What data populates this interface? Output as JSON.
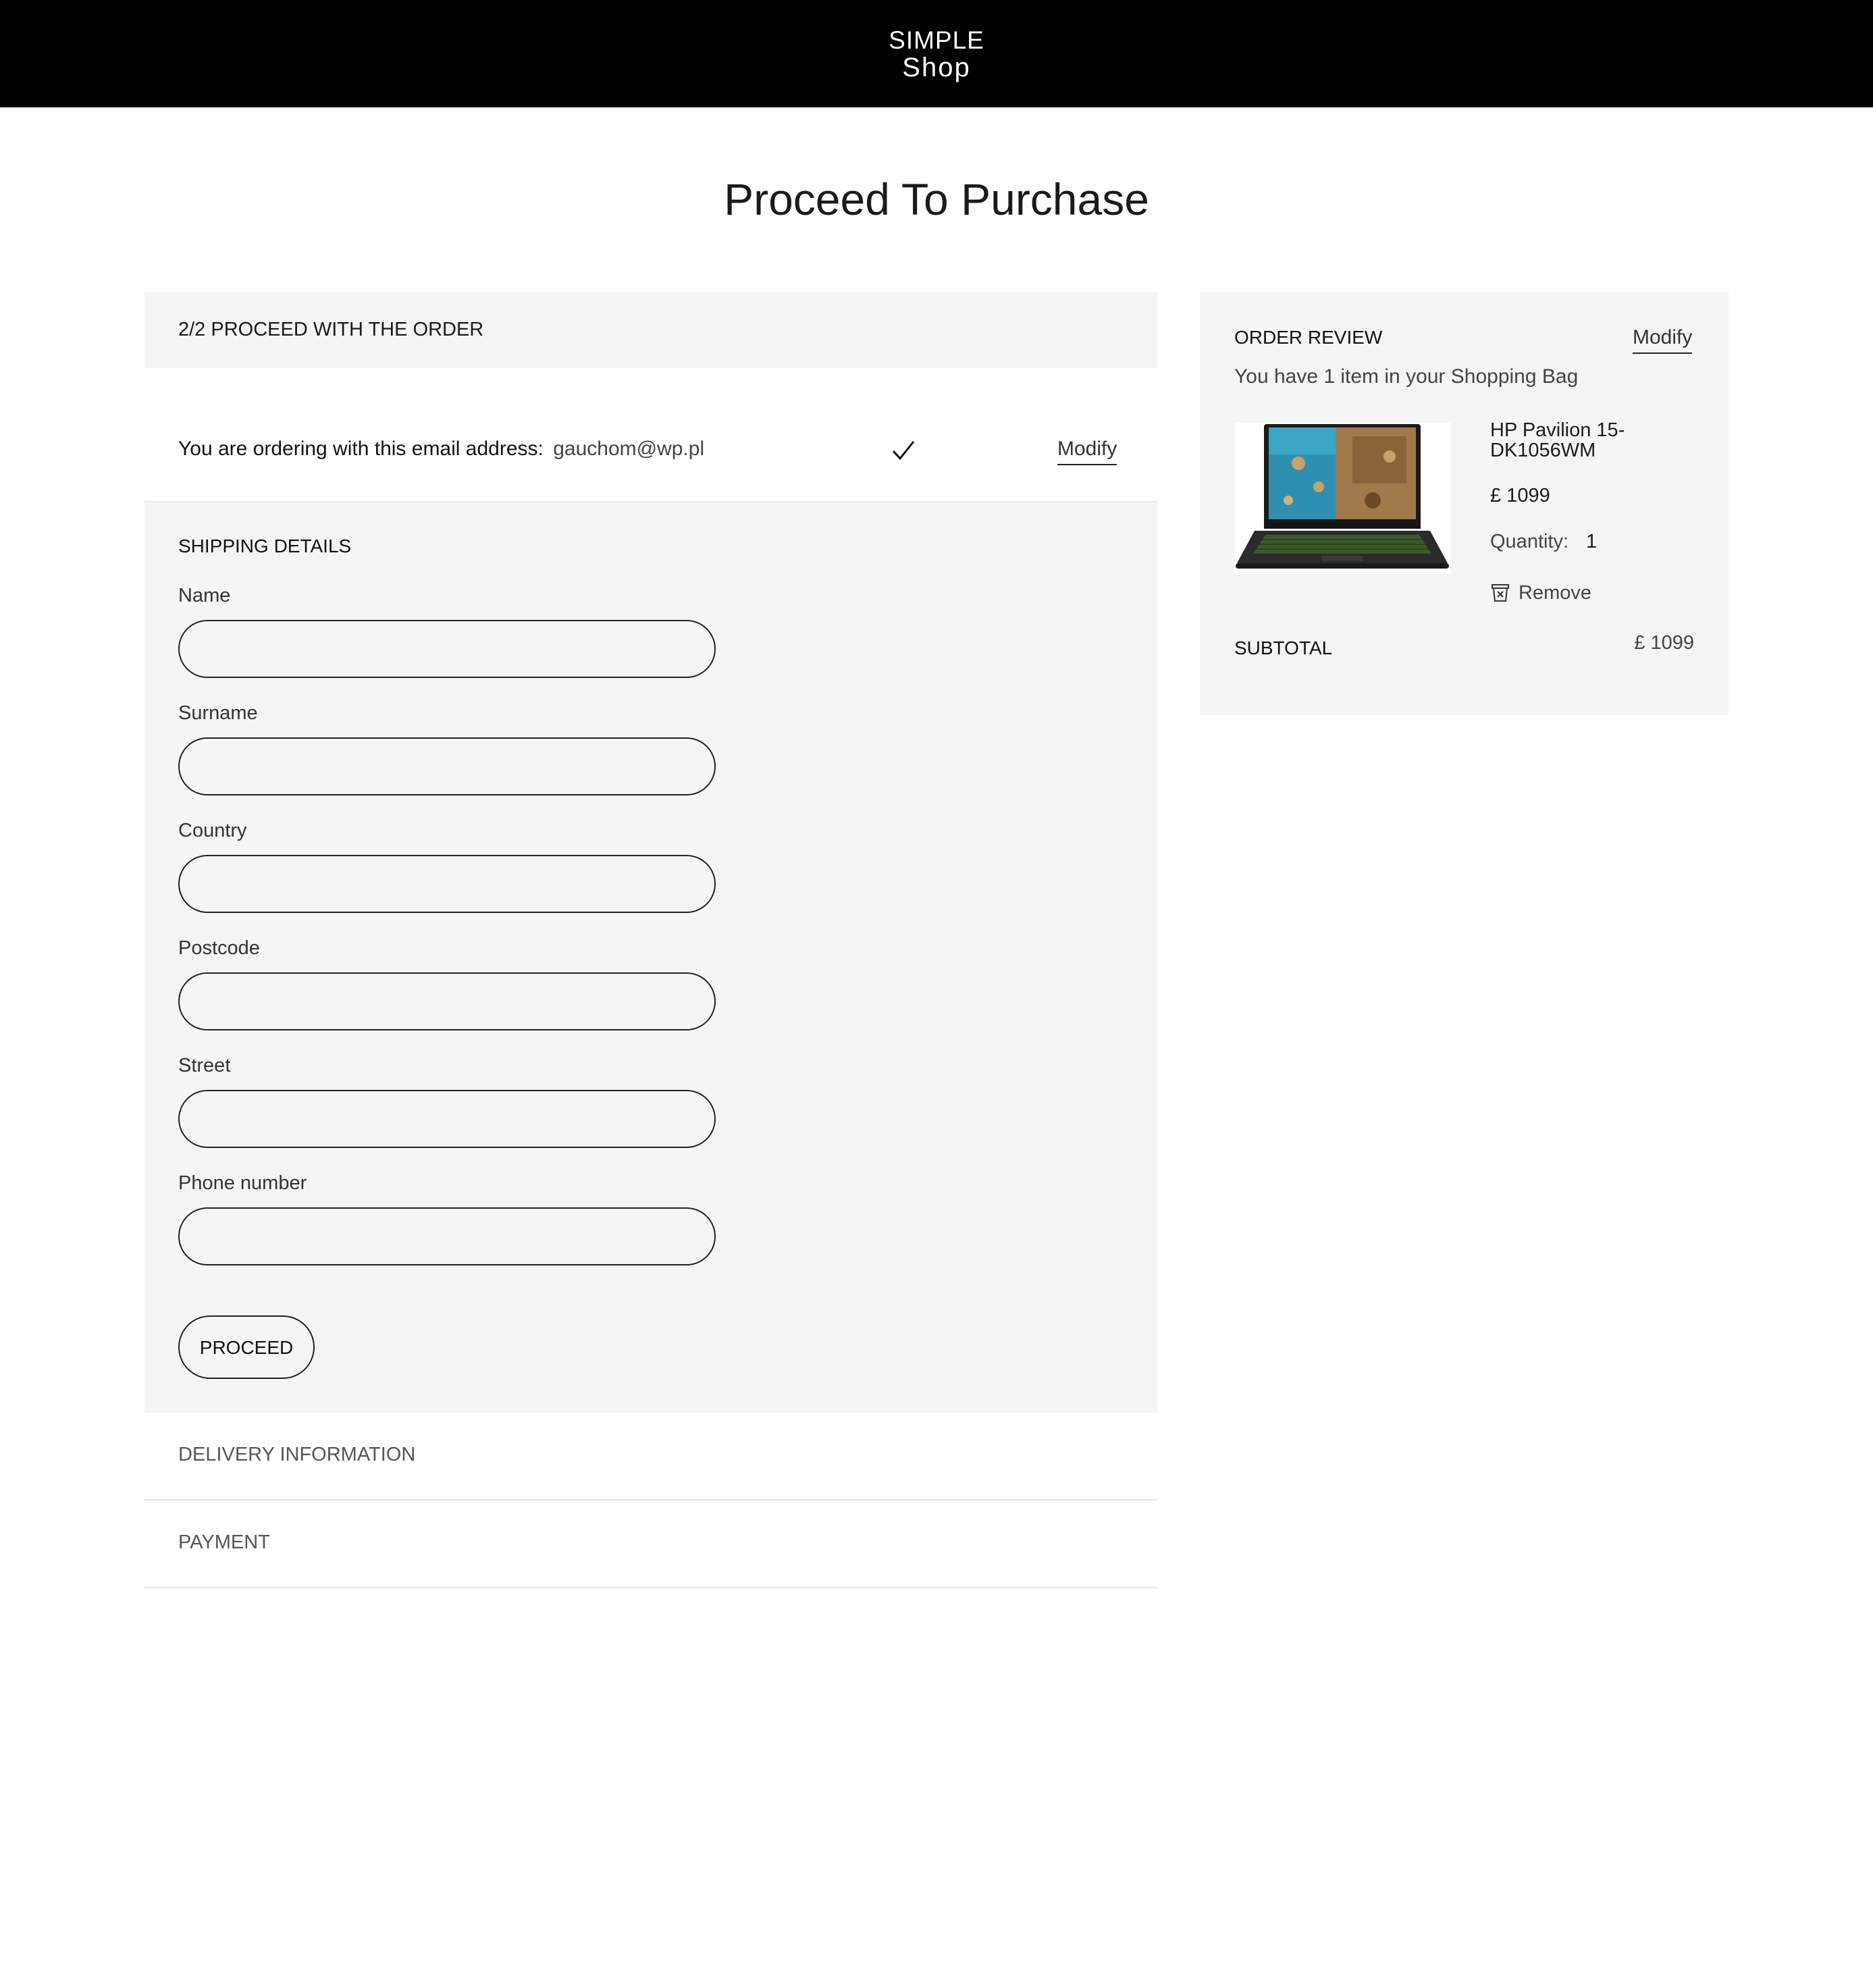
{
  "header": {
    "logo_line1": "SIMPLE",
    "logo_line2": "Shop"
  },
  "page_title": "Proceed To Purchase",
  "checkout": {
    "step_label": "2/2 PROCEED WITH THE ORDER",
    "email": {
      "label": "You are ordering with this email address:",
      "value": "gauchom@wp.pl",
      "modify_label": "Modify",
      "verified_icon": "check-icon"
    },
    "shipping": {
      "title": "SHIPPING DETAILS",
      "fields": [
        {
          "label": "Name",
          "value": "",
          "placeholder": ""
        },
        {
          "label": "Surname",
          "value": "",
          "placeholder": ""
        },
        {
          "label": "Country",
          "value": "",
          "placeholder": ""
        },
        {
          "label": "Postcode",
          "value": "",
          "placeholder": ""
        },
        {
          "label": "Street",
          "value": "",
          "placeholder": ""
        },
        {
          "label": "Phone number",
          "value": "",
          "placeholder": ""
        }
      ],
      "proceed_label": "PROCEED"
    },
    "delivery_label": "DELIVERY INFORMATION",
    "payment_label": "PAYMENT"
  },
  "order_review": {
    "title": "ORDER REVIEW",
    "modify_label": "Modify",
    "summary": "You have 1 item in your Shopping Bag",
    "item": {
      "name": "HP Pavilion 15-DK1056WM",
      "price": "£ 1099",
      "quantity_label": "Quantity:",
      "quantity": "1",
      "remove_label": "Remove",
      "remove_icon": "trash-icon"
    },
    "subtotal_label": "SUBTOTAL",
    "subtotal_value": "£ 1099"
  },
  "colors": {
    "header_bg": "#000000",
    "panel_bg": "#f5f5f5",
    "text": "#1a1a1a",
    "border": "#222222"
  }
}
